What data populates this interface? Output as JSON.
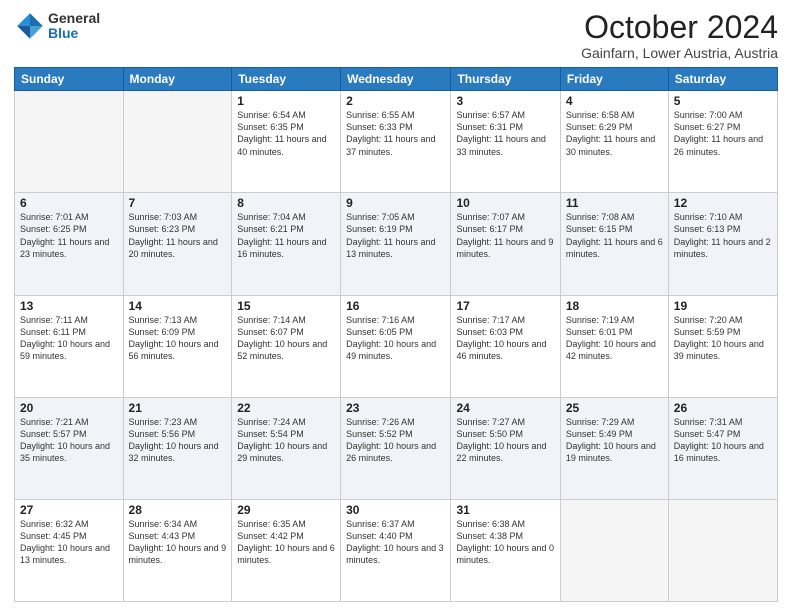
{
  "header": {
    "logo_general": "General",
    "logo_blue": "Blue",
    "month_title": "October 2024",
    "location": "Gainfarn, Lower Austria, Austria"
  },
  "weekdays": [
    "Sunday",
    "Monday",
    "Tuesday",
    "Wednesday",
    "Thursday",
    "Friday",
    "Saturday"
  ],
  "weeks": [
    [
      {
        "day": "",
        "sunrise": "",
        "sunset": "",
        "daylight": ""
      },
      {
        "day": "",
        "sunrise": "",
        "sunset": "",
        "daylight": ""
      },
      {
        "day": "1",
        "sunrise": "Sunrise: 6:54 AM",
        "sunset": "Sunset: 6:35 PM",
        "daylight": "Daylight: 11 hours and 40 minutes."
      },
      {
        "day": "2",
        "sunrise": "Sunrise: 6:55 AM",
        "sunset": "Sunset: 6:33 PM",
        "daylight": "Daylight: 11 hours and 37 minutes."
      },
      {
        "day": "3",
        "sunrise": "Sunrise: 6:57 AM",
        "sunset": "Sunset: 6:31 PM",
        "daylight": "Daylight: 11 hours and 33 minutes."
      },
      {
        "day": "4",
        "sunrise": "Sunrise: 6:58 AM",
        "sunset": "Sunset: 6:29 PM",
        "daylight": "Daylight: 11 hours and 30 minutes."
      },
      {
        "day": "5",
        "sunrise": "Sunrise: 7:00 AM",
        "sunset": "Sunset: 6:27 PM",
        "daylight": "Daylight: 11 hours and 26 minutes."
      }
    ],
    [
      {
        "day": "6",
        "sunrise": "Sunrise: 7:01 AM",
        "sunset": "Sunset: 6:25 PM",
        "daylight": "Daylight: 11 hours and 23 minutes."
      },
      {
        "day": "7",
        "sunrise": "Sunrise: 7:03 AM",
        "sunset": "Sunset: 6:23 PM",
        "daylight": "Daylight: 11 hours and 20 minutes."
      },
      {
        "day": "8",
        "sunrise": "Sunrise: 7:04 AM",
        "sunset": "Sunset: 6:21 PM",
        "daylight": "Daylight: 11 hours and 16 minutes."
      },
      {
        "day": "9",
        "sunrise": "Sunrise: 7:05 AM",
        "sunset": "Sunset: 6:19 PM",
        "daylight": "Daylight: 11 hours and 13 minutes."
      },
      {
        "day": "10",
        "sunrise": "Sunrise: 7:07 AM",
        "sunset": "Sunset: 6:17 PM",
        "daylight": "Daylight: 11 hours and 9 minutes."
      },
      {
        "day": "11",
        "sunrise": "Sunrise: 7:08 AM",
        "sunset": "Sunset: 6:15 PM",
        "daylight": "Daylight: 11 hours and 6 minutes."
      },
      {
        "day": "12",
        "sunrise": "Sunrise: 7:10 AM",
        "sunset": "Sunset: 6:13 PM",
        "daylight": "Daylight: 11 hours and 2 minutes."
      }
    ],
    [
      {
        "day": "13",
        "sunrise": "Sunrise: 7:11 AM",
        "sunset": "Sunset: 6:11 PM",
        "daylight": "Daylight: 10 hours and 59 minutes."
      },
      {
        "day": "14",
        "sunrise": "Sunrise: 7:13 AM",
        "sunset": "Sunset: 6:09 PM",
        "daylight": "Daylight: 10 hours and 56 minutes."
      },
      {
        "day": "15",
        "sunrise": "Sunrise: 7:14 AM",
        "sunset": "Sunset: 6:07 PM",
        "daylight": "Daylight: 10 hours and 52 minutes."
      },
      {
        "day": "16",
        "sunrise": "Sunrise: 7:16 AM",
        "sunset": "Sunset: 6:05 PM",
        "daylight": "Daylight: 10 hours and 49 minutes."
      },
      {
        "day": "17",
        "sunrise": "Sunrise: 7:17 AM",
        "sunset": "Sunset: 6:03 PM",
        "daylight": "Daylight: 10 hours and 46 minutes."
      },
      {
        "day": "18",
        "sunrise": "Sunrise: 7:19 AM",
        "sunset": "Sunset: 6:01 PM",
        "daylight": "Daylight: 10 hours and 42 minutes."
      },
      {
        "day": "19",
        "sunrise": "Sunrise: 7:20 AM",
        "sunset": "Sunset: 5:59 PM",
        "daylight": "Daylight: 10 hours and 39 minutes."
      }
    ],
    [
      {
        "day": "20",
        "sunrise": "Sunrise: 7:21 AM",
        "sunset": "Sunset: 5:57 PM",
        "daylight": "Daylight: 10 hours and 35 minutes."
      },
      {
        "day": "21",
        "sunrise": "Sunrise: 7:23 AM",
        "sunset": "Sunset: 5:56 PM",
        "daylight": "Daylight: 10 hours and 32 minutes."
      },
      {
        "day": "22",
        "sunrise": "Sunrise: 7:24 AM",
        "sunset": "Sunset: 5:54 PM",
        "daylight": "Daylight: 10 hours and 29 minutes."
      },
      {
        "day": "23",
        "sunrise": "Sunrise: 7:26 AM",
        "sunset": "Sunset: 5:52 PM",
        "daylight": "Daylight: 10 hours and 26 minutes."
      },
      {
        "day": "24",
        "sunrise": "Sunrise: 7:27 AM",
        "sunset": "Sunset: 5:50 PM",
        "daylight": "Daylight: 10 hours and 22 minutes."
      },
      {
        "day": "25",
        "sunrise": "Sunrise: 7:29 AM",
        "sunset": "Sunset: 5:49 PM",
        "daylight": "Daylight: 10 hours and 19 minutes."
      },
      {
        "day": "26",
        "sunrise": "Sunrise: 7:31 AM",
        "sunset": "Sunset: 5:47 PM",
        "daylight": "Daylight: 10 hours and 16 minutes."
      }
    ],
    [
      {
        "day": "27",
        "sunrise": "Sunrise: 6:32 AM",
        "sunset": "Sunset: 4:45 PM",
        "daylight": "Daylight: 10 hours and 13 minutes."
      },
      {
        "day": "28",
        "sunrise": "Sunrise: 6:34 AM",
        "sunset": "Sunset: 4:43 PM",
        "daylight": "Daylight: 10 hours and 9 minutes."
      },
      {
        "day": "29",
        "sunrise": "Sunrise: 6:35 AM",
        "sunset": "Sunset: 4:42 PM",
        "daylight": "Daylight: 10 hours and 6 minutes."
      },
      {
        "day": "30",
        "sunrise": "Sunrise: 6:37 AM",
        "sunset": "Sunset: 4:40 PM",
        "daylight": "Daylight: 10 hours and 3 minutes."
      },
      {
        "day": "31",
        "sunrise": "Sunrise: 6:38 AM",
        "sunset": "Sunset: 4:38 PM",
        "daylight": "Daylight: 10 hours and 0 minutes."
      },
      {
        "day": "",
        "sunrise": "",
        "sunset": "",
        "daylight": ""
      },
      {
        "day": "",
        "sunrise": "",
        "sunset": "",
        "daylight": ""
      }
    ]
  ]
}
